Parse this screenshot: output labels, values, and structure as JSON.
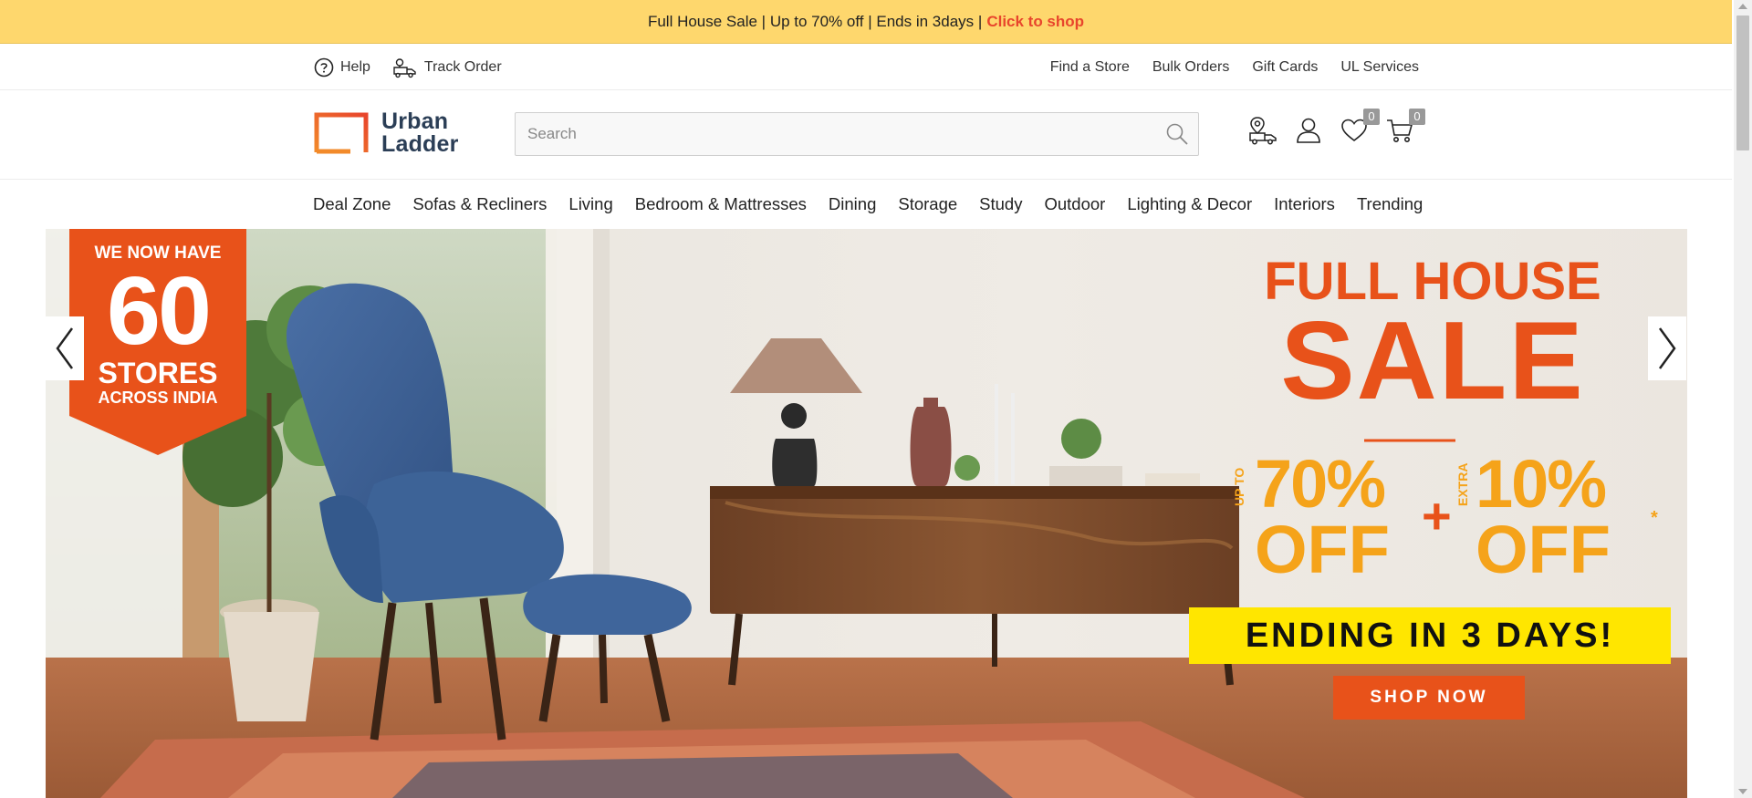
{
  "promo": {
    "text": "Full House Sale | Up to 70% off | Ends in 3days |",
    "cta": "Click to shop",
    "bg_color": "#fed76d",
    "cta_color": "#e8452c"
  },
  "utility": {
    "left": [
      {
        "label": "Help",
        "icon": "help-circle-icon"
      },
      {
        "label": "Track Order",
        "icon": "delivery-truck-icon"
      }
    ],
    "right": [
      "Find a Store",
      "Bulk Orders",
      "Gift Cards",
      "UL Services"
    ]
  },
  "header": {
    "logo_line1": "Urban",
    "logo_line2": "Ladder",
    "search_placeholder": "Search",
    "wishlist_count": "0",
    "cart_count": "0"
  },
  "nav": {
    "items": [
      "Deal Zone",
      "Sofas & Recliners",
      "Living",
      "Bedroom & Mattresses",
      "Dining",
      "Storage",
      "Study",
      "Outdoor",
      "Lighting & Decor",
      "Interiors",
      "Trending"
    ]
  },
  "hero": {
    "ribbon_line1": "WE NOW HAVE",
    "ribbon_number": "60",
    "ribbon_line2": "STORES",
    "ribbon_line3": "ACROSS INDIA",
    "headline1": "FULL HOUSE",
    "headline2": "SALE",
    "upto_label": "UP TO",
    "discount1": "70%",
    "off1": "OFF",
    "plus": "+",
    "extra_label": "EXTRA",
    "discount2": "10%",
    "off2": "OFF",
    "asterisk": "*",
    "ending": "ENDING IN 3 DAYS!",
    "shop_now": "SHOP NOW",
    "accent_orange": "#e8521a",
    "accent_yellow": "#f5a31a",
    "banner_yellow": "#ffe600"
  }
}
